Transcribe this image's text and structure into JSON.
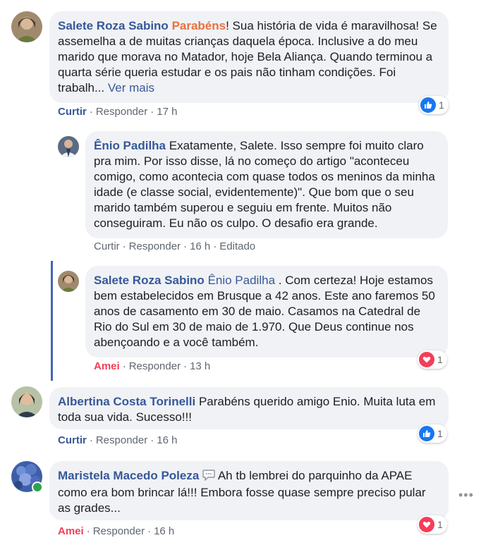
{
  "comments": [
    {
      "author": "Salete Roza Sabino",
      "mention": "Parabéns",
      "text": "! Sua história de vida é maravilhosa! Se assemelha a de muitas crianças daquela época. Inclusive a do meu marido que morava no Matador, hoje Bela Aliança. Quando terminou a quarta série queria estudar e os pais não tinham condições. Foi trabalh...",
      "see_more": "Ver mais",
      "action": "Curtir",
      "reply": "Responder",
      "time": "17 h",
      "reaction_count": "1"
    },
    {
      "author": "Ênio Padilha",
      "text": "Exatamente, Salete. Isso sempre foi muito claro pra mim. Por isso disse, lá no começo do artigo \"aconteceu comigo, como acontecia com quase todos os meninos da minha idade (e classe social, evidentemente)\". Que bom que o seu marido também superou e seguiu em frente. Muitos não conseguiram. Eu não os culpo. O desafio era grande.",
      "action": "Curtir",
      "reply": "Responder",
      "time": "16 h",
      "edited": "Editado"
    },
    {
      "author": "Salete Roza Sabino",
      "mention": "Ênio Padilha",
      "text": " . Com certeza! Hoje estamos bem estabelecidos em Brusque a 42 anos. Este ano faremos 50 anos de casamento em 30 de maio. Casamos na Catedral de Rio do Sul em 30 de maio de 1.970. Que Deus continue nos abençoando e a você também.",
      "action": "Amei",
      "reply": "Responder",
      "time": "13 h",
      "reaction_count": "1"
    },
    {
      "author": "Albertina Costa Torinelli",
      "text": "Parabéns querido amigo Enio. Muita luta em toda sua vida. Sucesso!!!",
      "action": "Curtir",
      "reply": "Responder",
      "time": "16 h",
      "reaction_count": "1"
    },
    {
      "author": "Maristela Macedo Poleza",
      "text": " Ah tb lembrei do parquinho da APAE como era bom brincar lá!!! Embora fosse quase sempre preciso pular as grades...",
      "action": "Amei",
      "reply": "Responder",
      "time": "16 h",
      "reaction_count": "1"
    }
  ],
  "separator": "·",
  "colors": {
    "author": "#365899",
    "bubble": "#f0f2f5",
    "like": "#1877f2",
    "love": "#f33e58",
    "mention_orange": "#e9703e"
  }
}
